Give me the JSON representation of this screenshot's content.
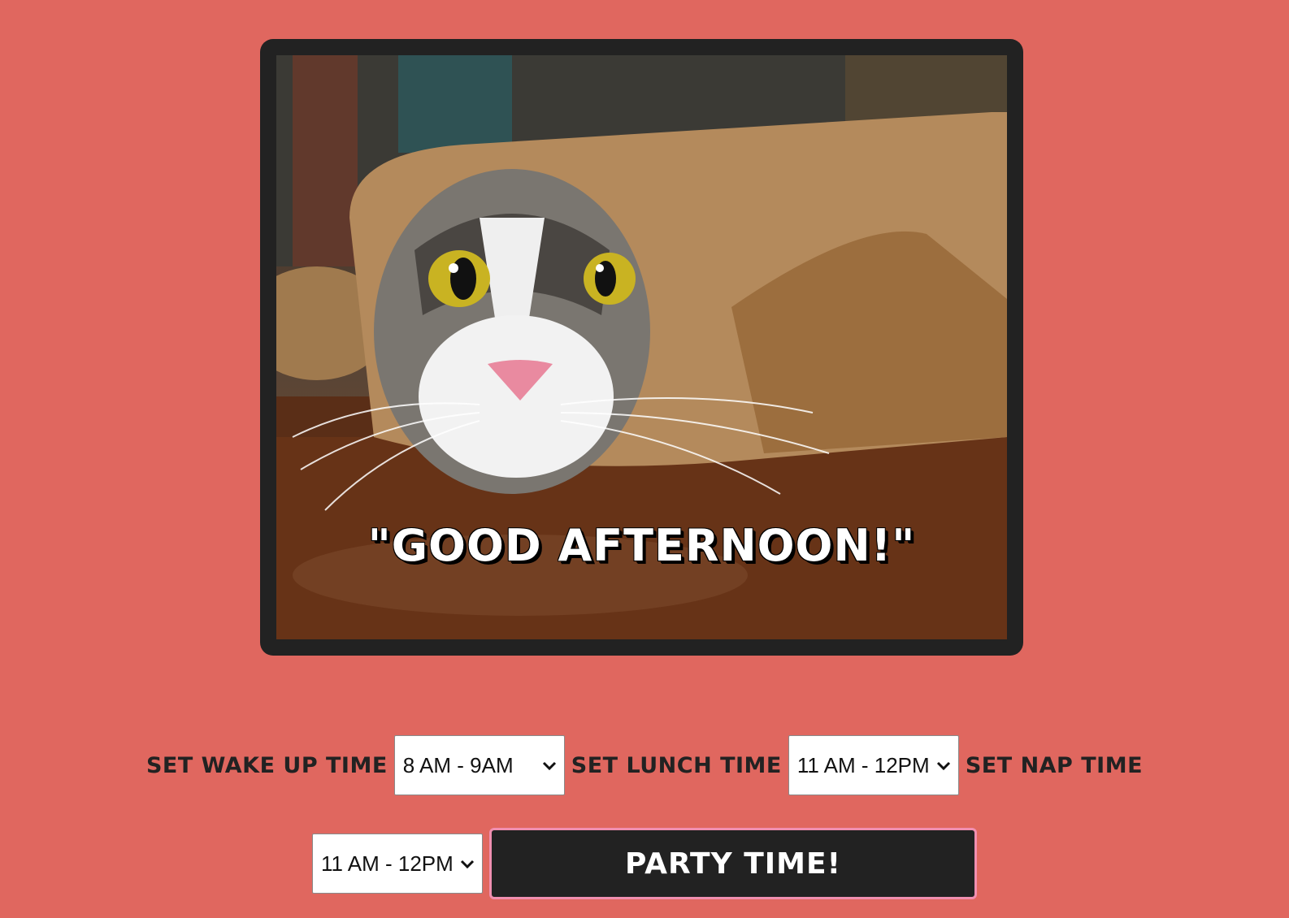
{
  "image": {
    "caption": "\"GOOD AFTERNOON!\"",
    "alt_icon": "cat-photo"
  },
  "controls": {
    "wake_label": "Set Wake Up Time",
    "wake_value": "8 AM - 9AM",
    "lunch_label": "Set Lunch Time",
    "lunch_value": "11 AM - 12PM",
    "nap_label": "Set Nap Time",
    "nap_value": "11 AM - 12PM",
    "party_label": "Party Time!"
  },
  "colors": {
    "background": "#e0675f",
    "frame": "#222222",
    "button": "#222222",
    "button_border": "#f08fb0"
  }
}
